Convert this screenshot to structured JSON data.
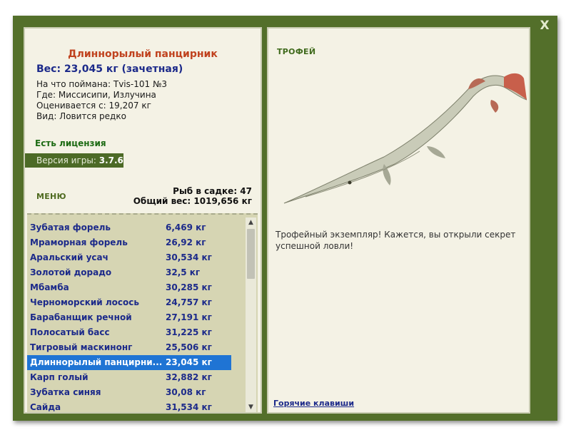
{
  "window": {
    "close_label": "X"
  },
  "fish": {
    "name": "Длиннорылый панцирник",
    "weight": "Вес: 23,045 кг (зачетная)",
    "caught_with": "На что поймана: Tvis-101 №3",
    "where": "Где: Миссисипи, Излучина",
    "rated_from": "Оценивается с: 19,207 кг",
    "kind": "Вид: Ловится редко"
  },
  "license": "Есть лицензия",
  "version": {
    "label": "Версия игры:",
    "value": "3.7.6"
  },
  "menu_label": "МЕНЮ",
  "cage": {
    "count": "Рыб в садке: 47",
    "total": "Общий вес: 1019,656 кг"
  },
  "catches": [
    {
      "name": "Зубатая форель",
      "weight": "6,469 кг"
    },
    {
      "name": "Мраморная форель",
      "weight": "26,92 кг"
    },
    {
      "name": "Аральский усач",
      "weight": "30,534 кг"
    },
    {
      "name": "Золотой дорадо",
      "weight": "32,5 кг"
    },
    {
      "name": "Мбамба",
      "weight": "30,285 кг"
    },
    {
      "name": "Черноморский лосось",
      "weight": "24,757 кг"
    },
    {
      "name": "Барабанщик речной",
      "weight": "27,191 кг"
    },
    {
      "name": "Полосатый басс",
      "weight": "31,225 кг"
    },
    {
      "name": "Тигровый маскинонг",
      "weight": "25,506 кг"
    },
    {
      "name": "Длиннорылый панцирни...",
      "weight": "23,045 кг"
    },
    {
      "name": "Карп голый",
      "weight": "32,882 кг"
    },
    {
      "name": "Зубатка синяя",
      "weight": "30,08 кг"
    },
    {
      "name": "Сайда",
      "weight": "31,534 кг"
    }
  ],
  "selected_index": 9,
  "trophy": {
    "title": "ТРОФЕЙ",
    "text": "Трофейный экземпляр! Кажется, вы открыли секрет успешной ловли!"
  },
  "hotkeys_link": "Горячие клавиши",
  "colors": {
    "frame": "#536f2a",
    "panel": "#f4f2e5",
    "list_bg": "#d6d5b3",
    "selection": "#1f74d4",
    "title_red": "#c0421e",
    "link_blue": "#1c2a8a"
  }
}
